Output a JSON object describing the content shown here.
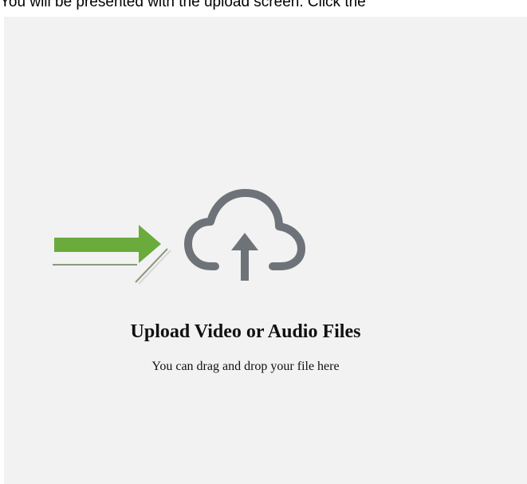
{
  "caption": {
    "text": "You will be presented with the upload screen. Click the"
  },
  "upload": {
    "title": "Upload Video or Audio Files",
    "subtitle": "You can drag and drop your file here",
    "icon": "cloud-upload-icon"
  },
  "annotation": {
    "icon": "pointer-arrow-icon",
    "color": "#6aab3c"
  },
  "colors": {
    "dropzone_bg": "#f2f2f2",
    "icon_gray": "#6e7379",
    "text": "#111111"
  }
}
